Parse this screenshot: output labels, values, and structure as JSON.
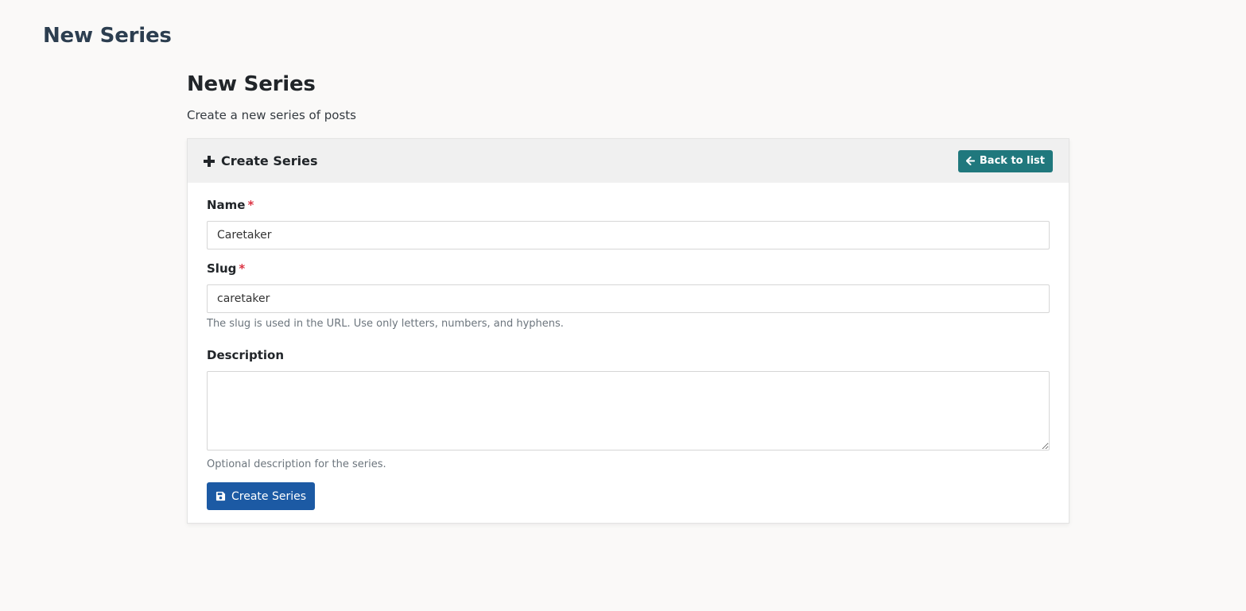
{
  "page_header": {
    "title": "New Series"
  },
  "content": {
    "title": "New Series",
    "subtitle": "Create a new series of posts"
  },
  "card": {
    "header_title": "Create Series",
    "header_icon": "plus-icon",
    "back_button": {
      "label": "Back to list",
      "icon": "arrow-left-icon"
    }
  },
  "form": {
    "name": {
      "label": "Name",
      "required_mark": "*",
      "value": "Caretaker"
    },
    "slug": {
      "label": "Slug",
      "required_mark": "*",
      "value": "caretaker",
      "help": "The slug is used in the URL. Use only letters, numbers, and hyphens."
    },
    "description": {
      "label": "Description",
      "value": "",
      "help": "Optional description for the series."
    },
    "submit": {
      "label": "Create Series",
      "icon": "save-icon"
    }
  },
  "colors": {
    "back_button": "#20787d",
    "submit_button": "#1c5aa4",
    "required": "#dc3545"
  }
}
